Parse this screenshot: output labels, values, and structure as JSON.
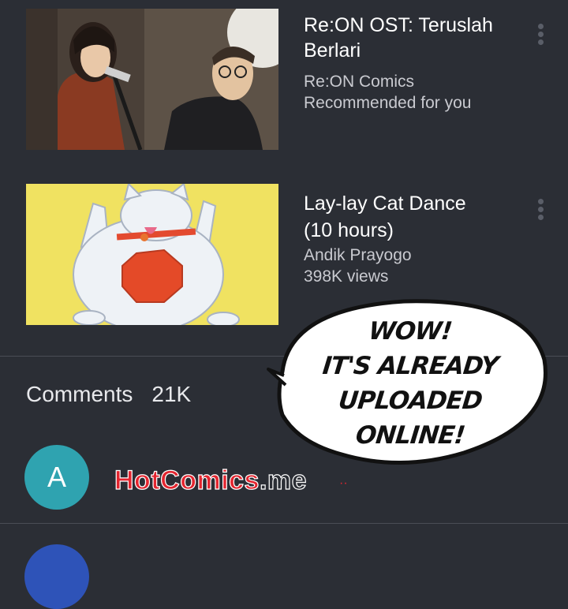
{
  "videos": [
    {
      "title_line1": "Re:ON OST: Teruslah",
      "title_line2": "Berlari",
      "channel": "Re:ON Comics",
      "info": "Recommended for you",
      "thumbnail": "two-singers-on-stage-image"
    },
    {
      "title_line1": "Lay-lay Cat Dance",
      "title_line2": "(10 hours)",
      "channel": "Andik Prayogo",
      "info": "398K views",
      "thumbnail": "dancing-white-cat-image"
    }
  ],
  "comments": {
    "label": "Comments",
    "count": "21K"
  },
  "first_comment": {
    "avatar_letter": "A",
    "avatar_color": "#2fa3b0"
  },
  "watermark": {
    "brand": "HotComics",
    "tld": ".me",
    "dots": "··"
  },
  "speech_bubble": {
    "line1": "WOW!",
    "line2": "IT'S ALREADY",
    "line3": "UPLOADED",
    "line4": "ONLINE!"
  },
  "colors": {
    "background": "#2b2e35",
    "watermark_red": "#e3252f",
    "second_avatar": "#2e53b8"
  }
}
